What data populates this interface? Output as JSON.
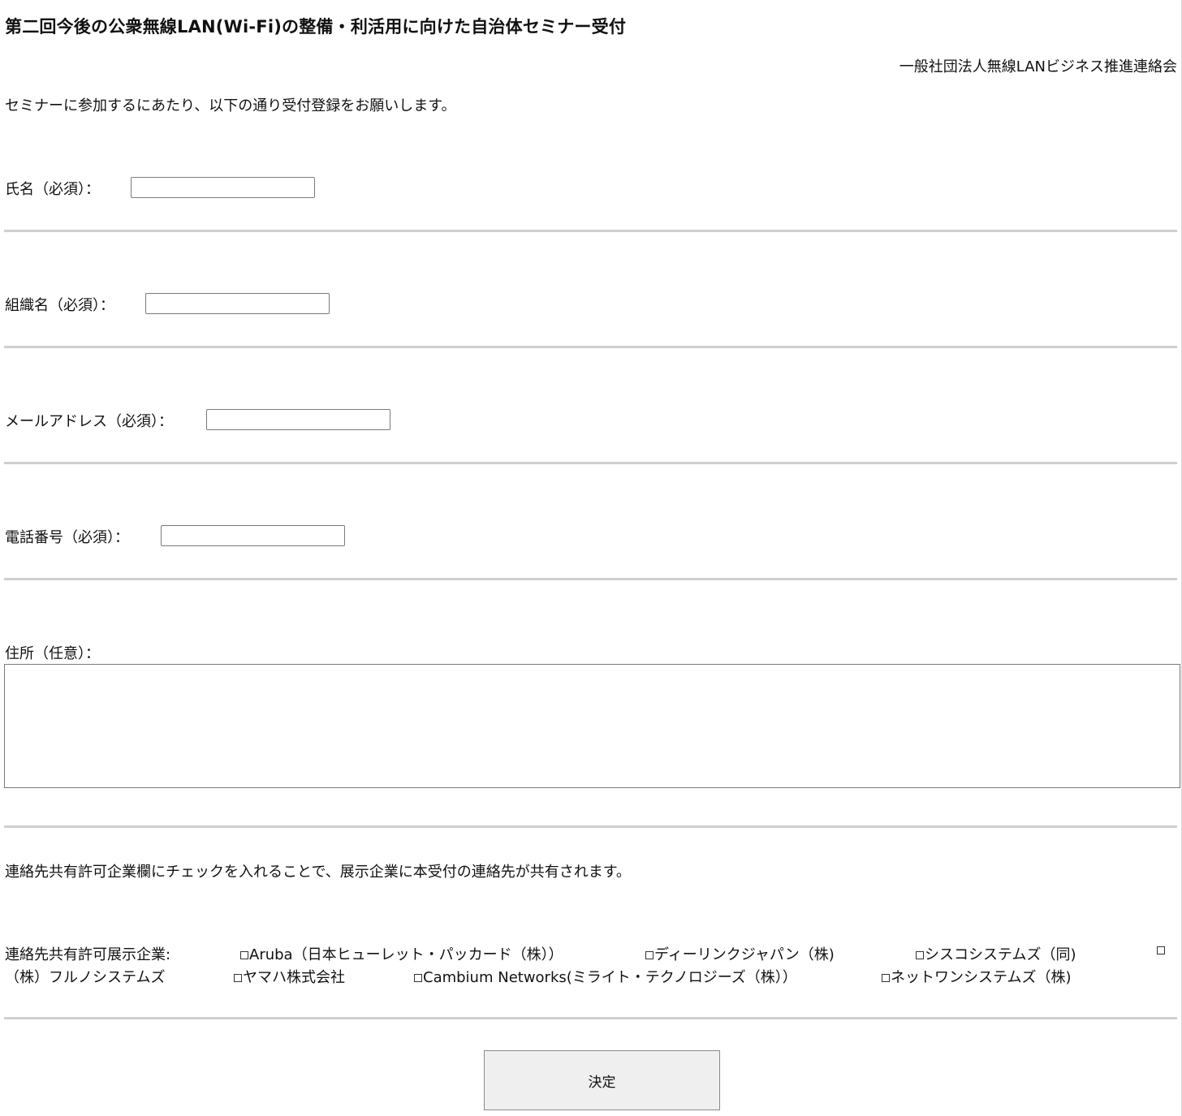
{
  "header": {
    "title": "第二回今後の公衆無線LAN(Wi-Fi)の整備・利活用に向けた自治体セミナー受付",
    "organization": "一般社団法人無線LANビジネス推進連絡会",
    "intro": "セミナーに参加するにあたり、以下の通り受付登録をお願いします。"
  },
  "form": {
    "name_label": "氏名（必須）：",
    "name_value": "",
    "org_label": "組織名（必須）：",
    "org_value": "",
    "email_label": "メールアドレス（必須）：",
    "email_value": "",
    "phone_label": "電話番号（必須）：",
    "phone_value": "",
    "address_label": "住所（任意）：",
    "address_value": "",
    "share_note": "連絡先共有許可企業欄にチェックを入れることで、展示企業に本受付の連絡先が共有されます。",
    "companies_label": "連絡先共有許可展示企業:",
    "companies": [
      {
        "label": "Aruba（日本ヒューレット・パッカード（株））",
        "checked": false
      },
      {
        "label": "ディーリンクジャパン（株)",
        "checked": false
      },
      {
        "label": "シスコシステムズ（同)",
        "checked": false
      },
      {
        "label": "",
        "checked": false
      },
      {
        "label": "（株）フルノシステムズ",
        "checked": false
      },
      {
        "label": "ヤマハ株式会社",
        "checked": false
      },
      {
        "label": "Cambium Networks(ミライト・テクノロジーズ（株））",
        "checked": false
      },
      {
        "label": "ネットワンシステムズ（株)",
        "checked": false
      }
    ],
    "submit_label": "決定"
  }
}
